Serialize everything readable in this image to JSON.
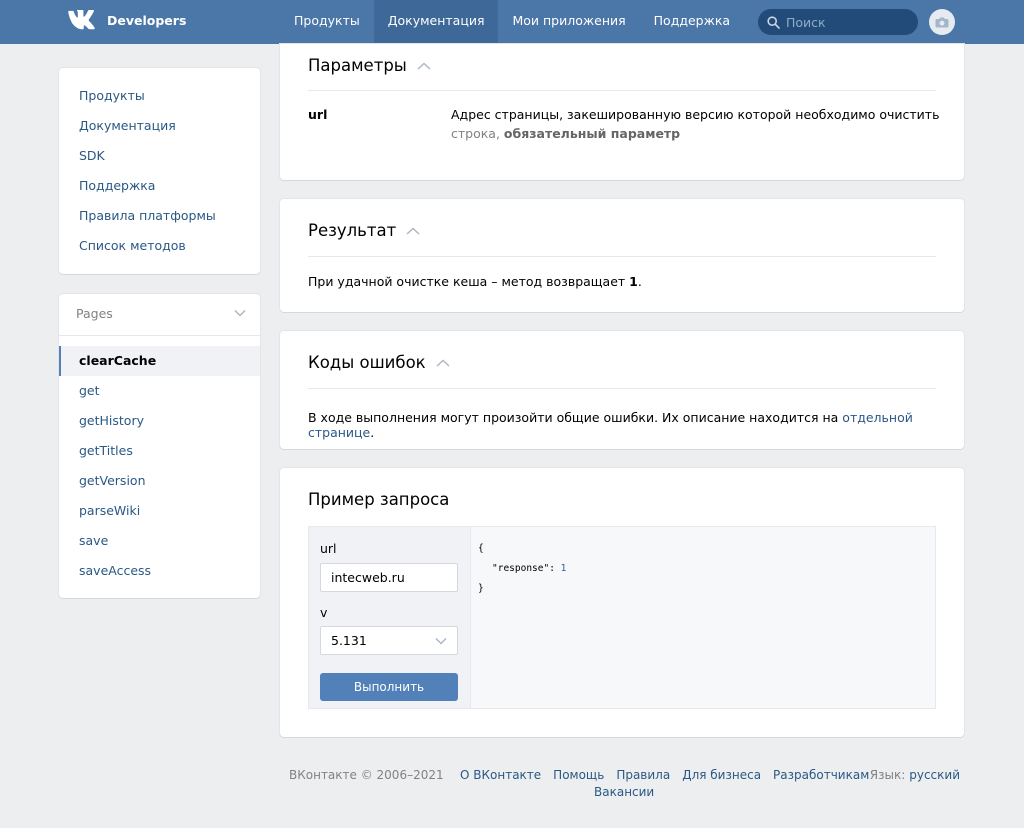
{
  "header": {
    "logo_text": "Developers",
    "nav": [
      "Продукты",
      "Документация",
      "Мои приложения",
      "Поддержка"
    ],
    "active_nav": 1,
    "search_placeholder": "Поиск",
    "accent": "#4a76a8"
  },
  "sidebar": {
    "menu": [
      "Продукты",
      "Документация",
      "SDK",
      "Поддержка",
      "Правила платформы",
      "Список методов"
    ],
    "pages_title": "Pages",
    "pages": [
      "clearCache",
      "get",
      "getHistory",
      "getTitles",
      "getVersion",
      "parseWiki",
      "save",
      "saveAccess"
    ],
    "active_page": 0
  },
  "params": {
    "title": "Параметры",
    "name": "url",
    "description": "Адрес страницы, закешированную версию которой необходимо очистить",
    "type_prefix": "строка,",
    "type_required": "обязательный параметр"
  },
  "result": {
    "title": "Результат",
    "text": "При удачной очистке кеша – метод возвращает",
    "value": "1",
    "suffix": "."
  },
  "errors": {
    "title": "Коды ошибок",
    "text": "В ходе выполнения могут произойти общие ошибки. Их описание находится на",
    "link": "отдельной странице",
    "suffix": "."
  },
  "example": {
    "title": "Пример запроса",
    "url_label": "url",
    "url_value": "intecweb.ru",
    "v_label": "v",
    "v_value": "5.131",
    "button": "Выполнить",
    "code_open": "{",
    "code_key": "\"response\":",
    "code_value": "1",
    "code_close": "}"
  },
  "footer": {
    "copyright": "ВКонтакте © 2006–2021",
    "links": [
      "О ВКонтакте",
      "Помощь",
      "Правила",
      "Для бизнеса",
      "Разработчикам"
    ],
    "links2": "Вакансии",
    "lang_label": "Язык:",
    "lang_value": "русский"
  }
}
